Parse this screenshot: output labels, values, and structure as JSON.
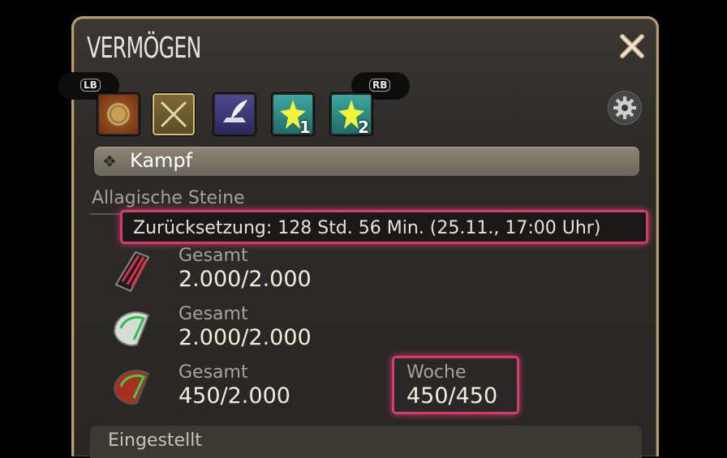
{
  "window": {
    "title": "VERMÖGEN"
  },
  "controls": {
    "lb": "LB",
    "rb": "RB"
  },
  "tabs": [
    {
      "icon": "gil-coin-icon"
    },
    {
      "icon": "crossed-swords-icon"
    },
    {
      "icon": "anvil-feather-icon"
    },
    {
      "icon": "yellow-star-icon",
      "badge": "1"
    },
    {
      "icon": "yellow-star-icon",
      "badge": "2"
    }
  ],
  "category": {
    "label": "Kampf"
  },
  "section": {
    "title": "Allagische Steine",
    "reset": "Zurücksetzung: 128 Std. 56 Min. (25.11., 17:00 Uhr)"
  },
  "currencies": [
    {
      "icon": "red-stone-icon",
      "total_label": "Gesamt",
      "total": "2.000/2.000"
    },
    {
      "icon": "green-stone-icon",
      "total_label": "Gesamt",
      "total": "2.000/2.000"
    },
    {
      "icon": "red-green-stone-icon",
      "total_label": "Gesamt",
      "total": "450/2.000",
      "week_label": "Woche",
      "week": "450/450"
    }
  ],
  "next_section": {
    "title": "Eingestellt"
  },
  "colors": {
    "highlight": "#d43b6e",
    "frame": "#b99d6b"
  }
}
